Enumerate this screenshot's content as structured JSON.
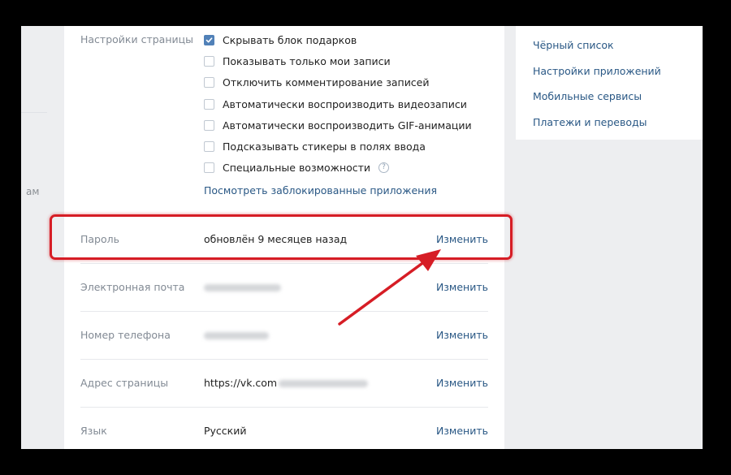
{
  "sidebar": {
    "fragment": "ам"
  },
  "page_settings": {
    "label": "Настройки страницы",
    "options": [
      {
        "label": "Скрывать блок подарков",
        "checked": true
      },
      {
        "label": "Показывать только мои записи",
        "checked": false
      },
      {
        "label": "Отключить комментирование записей",
        "checked": false
      },
      {
        "label": "Автоматически воспроизводить видеозаписи",
        "checked": false
      },
      {
        "label": "Автоматически воспроизводить GIF-анимации",
        "checked": false
      },
      {
        "label": "Подсказывать стикеры в полях ввода",
        "checked": false
      },
      {
        "label": "Специальные возможности",
        "checked": false,
        "help": "?"
      }
    ],
    "blocked_apps_link": "Посмотреть заблокированные приложения"
  },
  "rows": [
    {
      "label": "Пароль",
      "value": "обновлён 9 месяцев назад",
      "action": "Изменить"
    },
    {
      "label": "Электронная почта",
      "value": "",
      "action": "Изменить"
    },
    {
      "label": "Номер телефона",
      "value": "",
      "action": "Изменить"
    },
    {
      "label": "Адрес страницы",
      "value": "https://vk.com",
      "action": "Изменить"
    },
    {
      "label": "Язык",
      "value": "Русский",
      "action": "Изменить"
    }
  ],
  "side_menu": {
    "items": [
      "Чёрный список",
      "Настройки приложений",
      "Мобильные сервисы",
      "Платежи и переводы"
    ]
  },
  "colors": {
    "link": "#2a5885",
    "checkbox": "#5181b8",
    "highlight": "#d61d25"
  }
}
